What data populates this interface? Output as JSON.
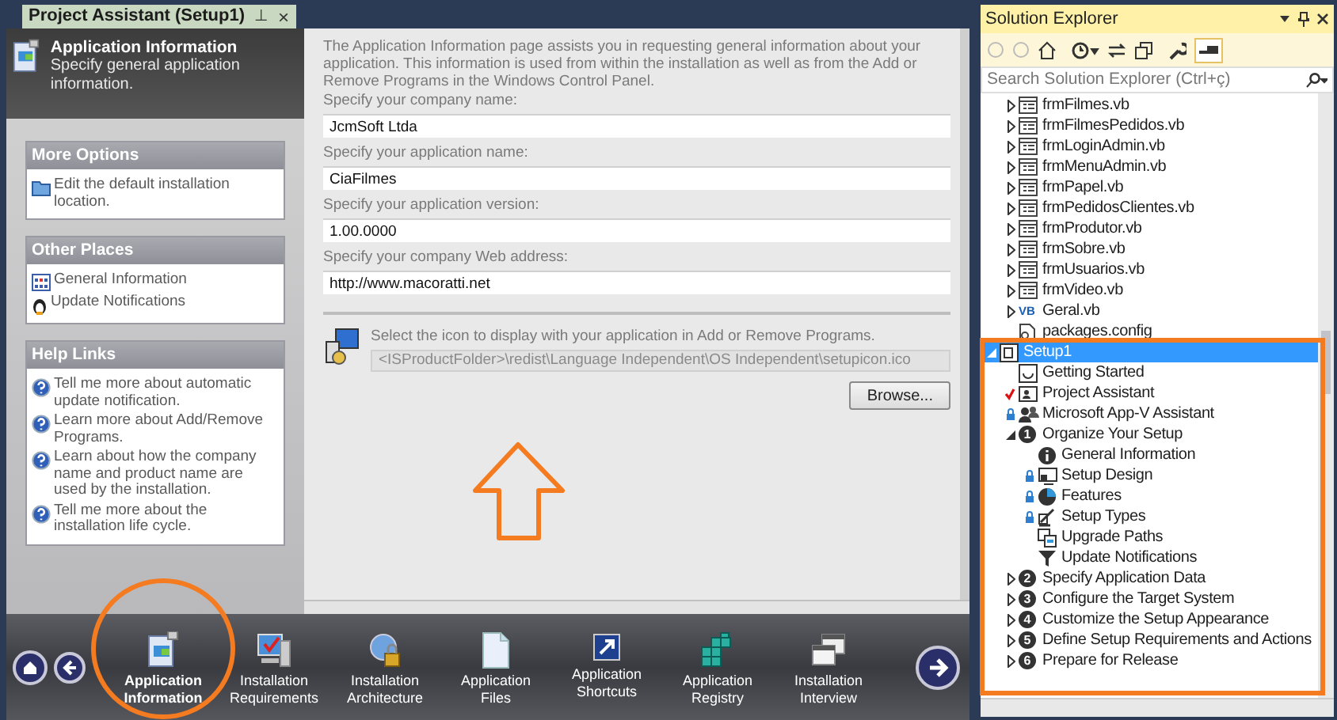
{
  "project_assistant": {
    "tab": {
      "title": "Project Assistant (Setup1)",
      "pin": "⊥",
      "close": "×"
    },
    "header": {
      "title": "Application Information",
      "subtitle": "Specify general application information."
    },
    "panels": [
      {
        "title": "More Options",
        "links": [
          {
            "kind": "folder",
            "text": "Edit the default installation location."
          }
        ]
      },
      {
        "title": "Other Places",
        "links": [
          {
            "kind": "grid",
            "text": "General Information"
          },
          {
            "kind": "notify",
            "text": "Update Notifications"
          }
        ]
      },
      {
        "title": "Help Links",
        "links": [
          {
            "kind": "help",
            "text": "Tell me more about automatic update notification."
          },
          {
            "kind": "help",
            "text": "Learn more about Add/Remove Programs."
          },
          {
            "kind": "help",
            "text": "Learn about how the company name and product name are used by the installation."
          },
          {
            "kind": "help",
            "text": "Tell me more about the installation life cycle."
          }
        ]
      }
    ],
    "description": "The Application Information page assists you in requesting general information about your application. This information is used from within the installation as well as from the Add or Remove Programs in the Windows Control Panel.",
    "fields": [
      {
        "label": "Specify your company name:",
        "value": "JcmSoft Ltda"
      },
      {
        "label": "Specify your application name:",
        "value": "CiaFilmes"
      },
      {
        "label": "Specify your application version:",
        "value": "1.00.0000"
      },
      {
        "label": "Specify your company Web address:",
        "value": "http://www.macoratti.net"
      }
    ],
    "icon_section": {
      "label": "Select the icon to display with your application in Add or Remove Programs.",
      "path": "<ISProductFolder>\\redist\\Language Independent\\OS Independent\\setupicon.ico",
      "button": "Browse..."
    },
    "nav": [
      {
        "kind": "appinfo",
        "label": "Application Information",
        "selected": true
      },
      {
        "kind": "monitor",
        "label": "Installation Requirements",
        "selected": false
      },
      {
        "kind": "lockglobe",
        "label": "Installation Architecture",
        "selected": false
      },
      {
        "kind": "file",
        "label": "Application Files",
        "selected": false
      },
      {
        "kind": "shortcut",
        "label": "Application Shortcuts",
        "selected": false
      },
      {
        "kind": "registry",
        "label": "Application Registry",
        "selected": false
      },
      {
        "kind": "windows",
        "label": "Installation Interview",
        "selected": false
      }
    ]
  },
  "solution_explorer": {
    "title": "Solution Explorer",
    "search": {
      "placeholder": "Search Solution Explorer (Ctrl+ç)"
    },
    "file_rows": [
      {
        "kind": "form",
        "label": "frmFilmes.vb",
        "expanded": false,
        "selected": false
      },
      {
        "kind": "form",
        "label": "frmFilmesPedidos.vb",
        "expanded": false,
        "selected": false
      },
      {
        "kind": "form",
        "label": "frmLoginAdmin.vb",
        "expanded": false,
        "selected": false
      },
      {
        "kind": "form",
        "label": "frmMenuAdmin.vb",
        "expanded": false,
        "selected": false
      },
      {
        "kind": "form",
        "label": "frmPapel.vb",
        "expanded": false,
        "selected": false
      },
      {
        "kind": "form",
        "label": "frmPedidosClientes.vb",
        "expanded": false,
        "selected": false
      },
      {
        "kind": "form",
        "label": "frmProdutor.vb",
        "expanded": false,
        "selected": false
      },
      {
        "kind": "form",
        "label": "frmSobre.vb",
        "expanded": false,
        "selected": false
      },
      {
        "kind": "form",
        "label": "frmUsuarios.vb",
        "expanded": false,
        "selected": false
      },
      {
        "kind": "form",
        "label": "frmVideo.vb",
        "expanded": false,
        "selected": false
      },
      {
        "kind": "vb",
        "icon_text": "VB",
        "label": "Geral.vb",
        "expanded": false,
        "selected": false
      },
      {
        "kind": "config",
        "label": "packages.config",
        "selected": false
      }
    ],
    "tree": [
      {
        "kind": "setup",
        "label": "Setup1",
        "expanded": true,
        "selected": true,
        "children": [
          {
            "kind": "page",
            "label": "Getting Started",
            "checked": false,
            "locked": false,
            "selected": false
          },
          {
            "kind": "assistant",
            "label": "Project Assistant",
            "checked": true,
            "locked": false,
            "selected": false
          },
          {
            "kind": "people",
            "label": "Microsoft App-V Assistant",
            "checked": false,
            "locked": true,
            "selected": false
          },
          {
            "kind": "step",
            "step": "1",
            "label": "Organize Your Setup",
            "expanded": true,
            "selected": false,
            "children": [
              {
                "kind": "info",
                "label": "General Information",
                "locked": false,
                "selected": false
              },
              {
                "kind": "design",
                "label": "Setup Design",
                "locked": true,
                "selected": false
              },
              {
                "kind": "pie",
                "label": "Features",
                "locked": true,
                "selected": false
              },
              {
                "kind": "pen",
                "label": "Setup Types",
                "locked": true,
                "selected": false
              },
              {
                "kind": "upgrade",
                "label": "Upgrade Paths",
                "locked": false,
                "selected": false
              },
              {
                "kind": "funnel",
                "label": "Update Notifications",
                "locked": false,
                "selected": false
              }
            ]
          },
          {
            "kind": "step",
            "step": "2",
            "label": "Specify Application Data",
            "expanded": false,
            "selected": false
          },
          {
            "kind": "step",
            "step": "3",
            "label": "Configure the Target System",
            "expanded": false,
            "selected": false
          },
          {
            "kind": "step",
            "step": "4",
            "label": "Customize the Setup Appearance",
            "expanded": false,
            "selected": false
          },
          {
            "kind": "step",
            "step": "5",
            "label": "Define Setup Requirements and Actions",
            "expanded": false,
            "selected": false
          },
          {
            "kind": "step",
            "step": "6",
            "label": "Prepare for Release",
            "expanded": false,
            "selected": false
          }
        ]
      }
    ]
  }
}
